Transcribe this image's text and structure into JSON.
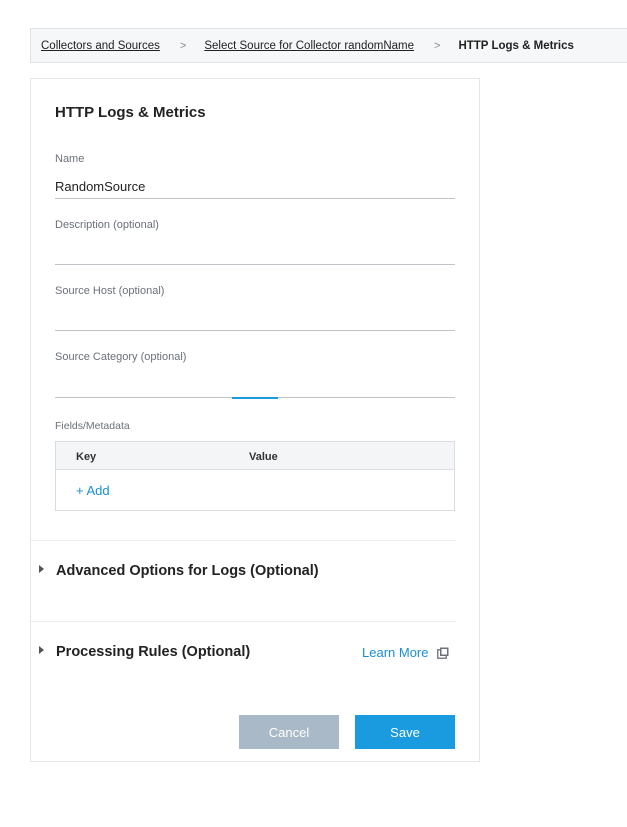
{
  "breadcrumb": {
    "items": [
      {
        "label": "Collectors and Sources"
      },
      {
        "label": "Select Source for Collector randomName"
      },
      {
        "label": "HTTP Logs & Metrics"
      }
    ],
    "separator": ">"
  },
  "form": {
    "title": "HTTP Logs & Metrics",
    "name": {
      "label": "Name",
      "value": "RandomSource"
    },
    "description": {
      "label": "Description (optional)",
      "value": ""
    },
    "source_host": {
      "label": "Source Host (optional)",
      "value": ""
    },
    "source_category": {
      "label": "Source Category (optional)",
      "value": ""
    },
    "fields_label": "Fields/Metadata",
    "fields_table": {
      "key_header": "Key",
      "value_header": "Value",
      "add_label": "+ Add"
    },
    "advanced_logs": {
      "label": "Advanced Options for Logs (Optional)"
    },
    "processing_rules": {
      "label": "Processing Rules (Optional)",
      "learn_more": "Learn More"
    },
    "cancel_label": "Cancel",
    "save_label": "Save"
  },
  "colors": {
    "accent": "#1a9be0",
    "link": "#1a8fd6",
    "cancel_bg": "#a9b9c8"
  },
  "icons": {
    "caret": "caret-right-icon",
    "external": "external-link-icon"
  }
}
